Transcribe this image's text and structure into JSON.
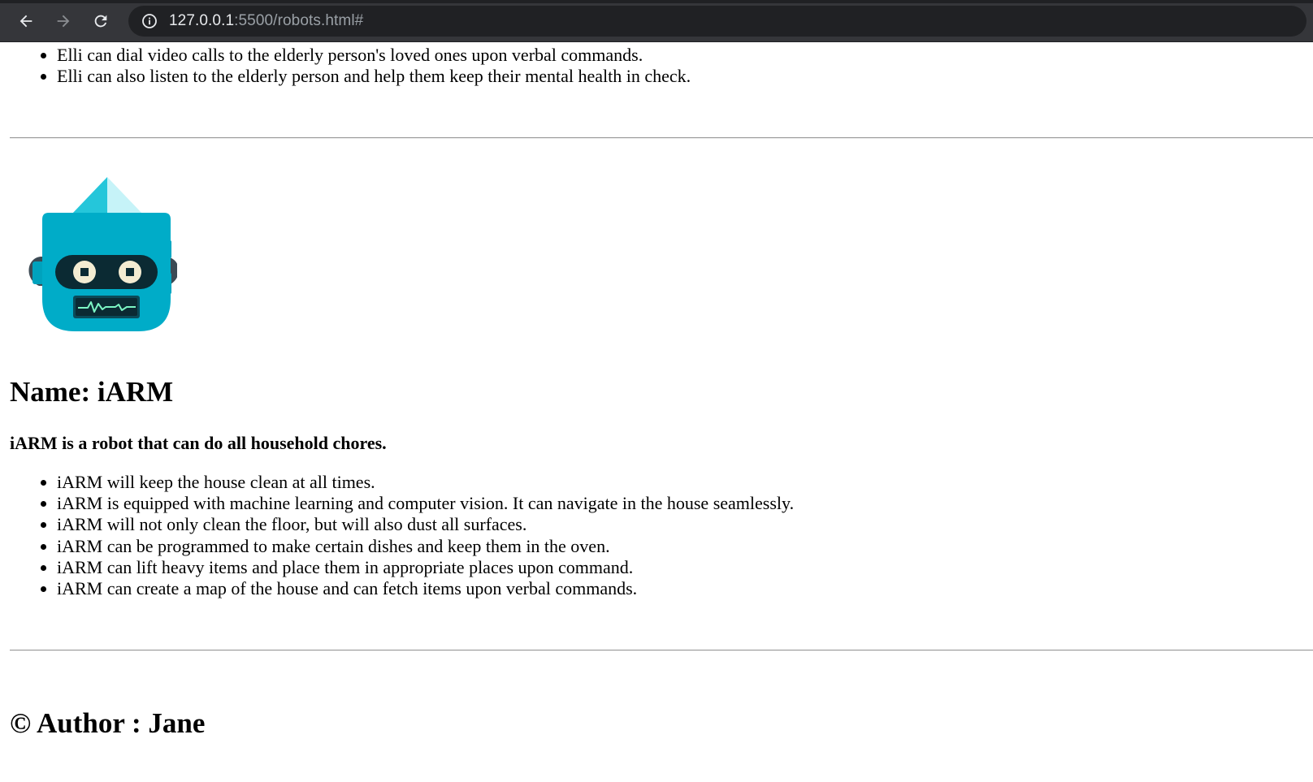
{
  "browser": {
    "url_host": "127.0.0.1",
    "url_rest": ":5500/robots.html#",
    "back_icon": "arrow-left-icon",
    "forward_icon": "arrow-right-icon",
    "reload_icon": "reload-icon",
    "site_info_icon": "info-icon"
  },
  "elli": {
    "features": [
      "Elli can dial video calls to the elderly person's loved ones upon verbal commands.",
      "Elli can also listen to the elderly person and help them keep their mental health in check."
    ]
  },
  "iarm": {
    "icon": "robot-head-icon",
    "name": "Name: iARM",
    "description": "iARM is a robot that can do all household chores.",
    "features": [
      "iARM will keep the house clean at all times.",
      "iARM is equipped with machine learning and computer vision. It can navigate in the house seamlessly.",
      "iARM will not only clean the floor, but will also dust all surfaces.",
      "iARM can be programmed to make certain dishes and keep them in the oven.",
      "iARM can lift heavy items and place them in appropriate places upon command.",
      "iARM can create a map of the house and can fetch items upon verbal commands."
    ]
  },
  "footer": {
    "author": "© Author : Jane"
  },
  "colors": {
    "chrome_bg": "#35363a",
    "omnibox_bg": "#202124",
    "robot_primary": "#00acc8",
    "robot_dark": "#0b2a33",
    "robot_eye": "#f3ecd2",
    "robot_screen_line": "#7cf5c4"
  }
}
